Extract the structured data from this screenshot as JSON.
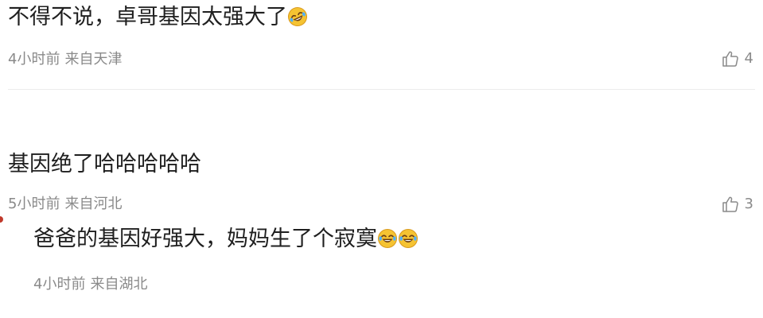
{
  "comments": [
    {
      "text": "不得不说，卓哥基因太强大了",
      "emoji": "rolling-laugh-emoji",
      "time": "4小时前",
      "location": "来自天津",
      "likes": "4"
    },
    {
      "text": "基因绝了哈哈哈哈哈",
      "time": "5小时前",
      "location": "来自河北",
      "likes": "3"
    },
    {
      "text": "爸爸的基因好强大，妈妈生了个寂寞",
      "emoji": "tears-of-joy-emoji",
      "time": "4小时前",
      "location": "来自湖北"
    }
  ],
  "colors": {
    "text": "#1f1f1f",
    "meta": "#8a8a8a",
    "divider": "#ececec",
    "emoji_face": "#f5c332"
  }
}
